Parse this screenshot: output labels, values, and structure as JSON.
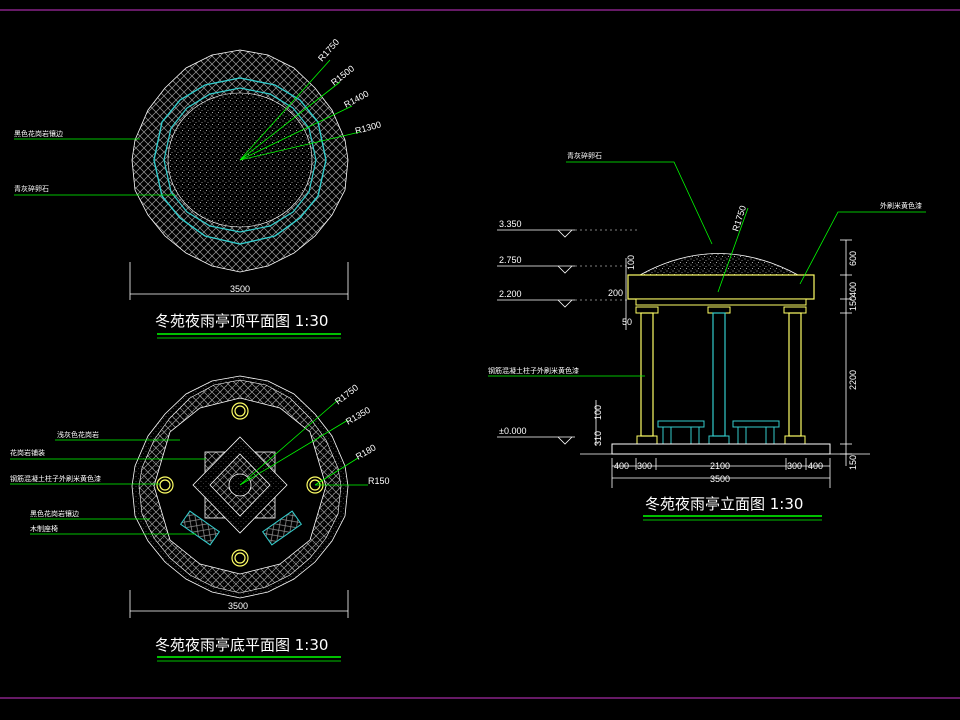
{
  "roof_plan": {
    "title": "冬苑夜雨亭顶平面图  1:30",
    "width_dim": "3500",
    "radii": [
      "R1750",
      "R1500",
      "R1400",
      "R1300"
    ],
    "labels": [
      "黑色花岗岩镶边",
      "青灰碎卵石"
    ]
  },
  "base_plan": {
    "title": "冬苑夜雨亭底平面图  1:30",
    "width_dim": "3500",
    "radii": [
      "R1750",
      "R1350",
      "R180",
      "R150"
    ],
    "labels": [
      "浅灰色花岗岩",
      "花岗岩铺装",
      "钢筋混凝土柱子外刷米黄色漆",
      "黑色花岗岩镶边",
      "木制座椅"
    ]
  },
  "elevation": {
    "title": "冬苑夜雨亭立面图  1:30",
    "levels": [
      "3.350",
      "2.750",
      "2.200",
      "±0.000"
    ],
    "labels": [
      "青灰碎卵石",
      "外刷米黄色漆",
      "钢筋混凝土柱子外刷米黄色漆"
    ],
    "radius": "R1750",
    "side_dims_left": [
      "100",
      "200",
      "50",
      "310",
      "100"
    ],
    "side_dims_right": [
      "600",
      "150",
      "400",
      "2200",
      "150"
    ],
    "bottom_dims": [
      "400",
      "300",
      "2100",
      "300",
      "400"
    ],
    "total_dim": "3500"
  }
}
